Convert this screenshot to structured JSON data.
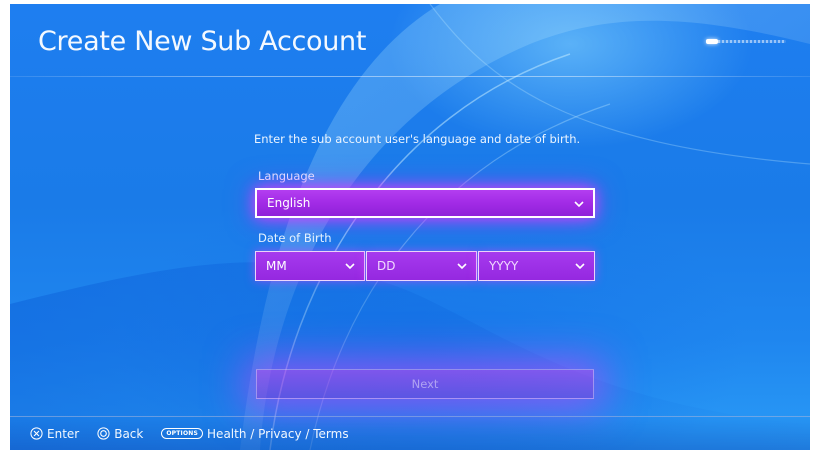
{
  "header": {
    "title": "Create New Sub Account",
    "progress": 0.15
  },
  "form": {
    "instruction": "Enter the sub account user's language and date of birth.",
    "language": {
      "label": "Language",
      "value": "English"
    },
    "date_of_birth": {
      "label": "Date of Birth",
      "month": "MM",
      "day": "DD",
      "year": "YYYY"
    },
    "next_label": "Next"
  },
  "footer": {
    "enter_label": "Enter",
    "back_label": "Back",
    "options_badge": "OPTIONS",
    "health_label": "Health / Privacy / Terms"
  },
  "colors": {
    "background": "#1e7ef0",
    "focus_accent": "#b33ef0"
  },
  "icons": {
    "enter": "cross-button-icon",
    "back": "circle-button-icon",
    "options": "options-button-icon",
    "dropdown": "chevron-down-icon"
  }
}
